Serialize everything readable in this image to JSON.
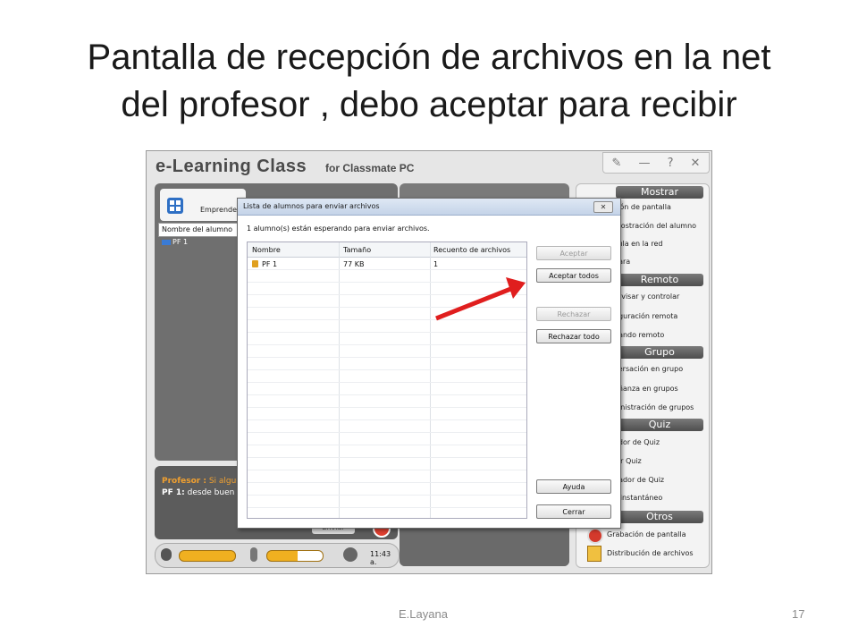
{
  "slide": {
    "title_line1": "Pantalla de recepción de archivos en la net",
    "title_line2": "del profesor , debo aceptar para recibir",
    "footer_author": "E.Layana",
    "footer_page": "17"
  },
  "app": {
    "title": "e-Learning Class",
    "subtitle": "for Classmate PC",
    "window_controls": [
      "✎",
      "—",
      "?",
      "✕"
    ],
    "group_label": "Emprendedor",
    "list_header": "Nombre del alumno",
    "student_row": "PF 1",
    "chat": [
      {
        "speaker": "Profesor :",
        "text": "Si algue",
        "color": "#f0a030"
      },
      {
        "speaker": "PF 1:",
        "text": "desde  buen",
        "color": "#ffffff"
      }
    ],
    "send_label": "Enviar",
    "time": "11:43 a.",
    "sections": {
      "mostrar": "Mostrar",
      "remoto": "Remoto",
      "grupo": "Grupo",
      "quiz": "Quiz",
      "otros": "Otros"
    },
    "items": {
      "mostrar": [
        "sión de pantalla",
        "mostración del alumno",
        "cula en la red",
        "hara"
      ],
      "remoto": [
        "ervisar y controlar",
        "figuración remota",
        "nando remoto"
      ],
      "grupo": [
        "versación en grupo",
        "eñanza en grupos",
        "ninistración de grupos"
      ],
      "quiz": [
        "ador de Quiz",
        "iar Quiz",
        "uador de Quiz",
        "z instantáneo"
      ],
      "otros": [
        "Grabación de pantalla",
        "Distribución de archivos"
      ]
    }
  },
  "dialog": {
    "title": "Lista de alumnos para enviar archivos",
    "close_label": "✕",
    "message": "1 alumno(s) están esperando para enviar archivos.",
    "columns": [
      "Nombre",
      "Tamaño",
      "Recuento de archivos"
    ],
    "rows": [
      {
        "name": "PF 1",
        "size": "77 KB",
        "count": "1"
      }
    ],
    "buttons": {
      "accept": "Aceptar",
      "accept_all": "Aceptar todos",
      "reject": "Rechazar",
      "reject_all": "Rechazar todo",
      "help": "Ayuda",
      "close": "Cerrar"
    }
  },
  "colors": {
    "arrow": "#e01e1e",
    "section_bg": "#5a5a5a",
    "accent_orange": "#f0b020"
  }
}
